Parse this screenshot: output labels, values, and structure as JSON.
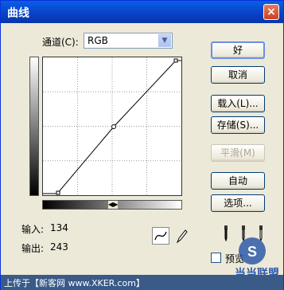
{
  "window": {
    "title": "曲线",
    "close_label": "×"
  },
  "channel": {
    "label": "通道(C):",
    "value": "RGB"
  },
  "buttons": {
    "ok": "好",
    "cancel": "取消",
    "load": "载入(L)...",
    "save": "存储(S)...",
    "smooth": "平滑(M)",
    "auto": "自动",
    "options": "选项..."
  },
  "readout": {
    "input_label": "输入:",
    "input_value": "134",
    "output_label": "输出:",
    "output_value": "243"
  },
  "preview": {
    "label": "预览"
  },
  "footer": {
    "text": "上传于【新客网 www.XKER.com】"
  },
  "watermark": {
    "text": "S 当当联盟"
  },
  "icons": {
    "curve_tool": "curve-icon",
    "pencil_tool": "pencil-icon",
    "droppers": [
      "black-dropper-icon",
      "gray-dropper-icon",
      "white-dropper-icon"
    ]
  },
  "colors": {
    "titlebar": "#0841c4",
    "dialog_bg": "#ece9d8",
    "footer_bg": "#3a5a88"
  }
}
